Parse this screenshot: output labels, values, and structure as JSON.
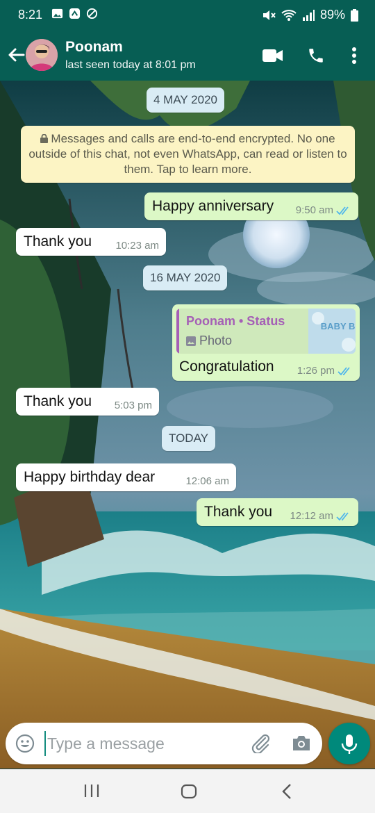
{
  "status_bar": {
    "time": "8:21",
    "battery": "89%"
  },
  "header": {
    "contact_name": "Poonam",
    "last_seen": "last seen today at 8:01 pm"
  },
  "chat": {
    "date_1": "4 MAY 2020",
    "encryption_notice": "Messages and calls are end-to-end encrypted. No one outside of this chat, not even WhatsApp, can read or listen to them. Tap to learn more.",
    "msg_1": {
      "text": "Happy anniversary",
      "time": "9:50 am"
    },
    "msg_2": {
      "text": "Thank you",
      "time": "10:23 am"
    },
    "date_2": "16 MAY 2020",
    "msg_3": {
      "quote_author": "Poonam • Status",
      "quote_type": "Photo",
      "thumb_text": "BABY BOY",
      "text": "Congratulation",
      "time": "1:26 pm"
    },
    "msg_4": {
      "text": "Thank you",
      "time": "5:03 pm"
    },
    "date_3": "TODAY",
    "msg_5": {
      "text": "Happy birthday dear",
      "time": "12:06 am"
    },
    "msg_6": {
      "text": "Thank you",
      "time": "12:12 am"
    }
  },
  "composer": {
    "placeholder": "Type a message"
  },
  "colors": {
    "header": "#075e54",
    "outgoing_bubble": "#dcf8c6",
    "incoming_bubble": "#ffffff",
    "accent": "#00897b",
    "read_tick": "#4fb6ec",
    "quote_author": "#a55fb6"
  },
  "icons": [
    "back-arrow-icon",
    "video-call-icon",
    "phone-icon",
    "more-options-icon",
    "emoji-icon",
    "attach-icon",
    "camera-icon",
    "mic-icon",
    "lock-icon",
    "photo-icon",
    "double-tick-icon"
  ]
}
